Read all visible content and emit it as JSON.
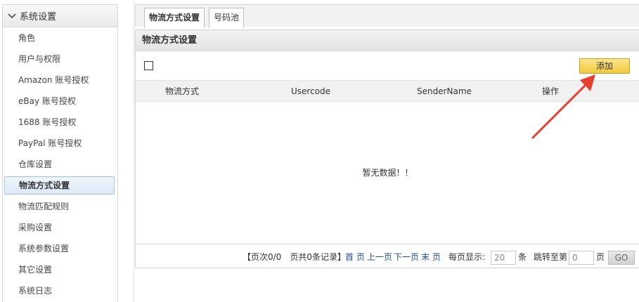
{
  "sidebar": {
    "section_title": "系统设置",
    "items": [
      {
        "label": "角色"
      },
      {
        "label": "用户与权限"
      },
      {
        "label": "Amazon 账号授权"
      },
      {
        "label": "eBay 账号授权"
      },
      {
        "label": "1688 账号授权"
      },
      {
        "label": "PayPal 账号授权"
      },
      {
        "label": "仓库设置"
      },
      {
        "label": "物流方式设置"
      },
      {
        "label": "物流匹配规则"
      },
      {
        "label": "采购设置"
      },
      {
        "label": "系统参数设置"
      },
      {
        "label": "其它设置"
      },
      {
        "label": "系统日志"
      }
    ],
    "active_index": 7
  },
  "tabs": [
    {
      "label": "物流方式设置"
    },
    {
      "label": "号码池"
    }
  ],
  "panel": {
    "title": "物流方式设置",
    "add_label": "添加",
    "columns": [
      "物流方式",
      "Usercode",
      "SenderName",
      "操作"
    ],
    "empty_text": "暂无数据！！"
  },
  "pager": {
    "summary": "【页次0/0　页共0条记录】",
    "first": "首 页",
    "prev": "上一页",
    "next": "下一页",
    "last": "末 页",
    "per_page_label": "每页显示:",
    "per_page_value": "20",
    "per_page_unit": "条",
    "jump_label": "跳转至第",
    "jump_value": "0",
    "jump_unit": "页",
    "go_label": "GO"
  },
  "colors": {
    "accent_button": "#f1c93f",
    "active_item_bg": "#dde9f6",
    "link": "#1f4e97",
    "annotation_arrow": "#e8402f"
  }
}
